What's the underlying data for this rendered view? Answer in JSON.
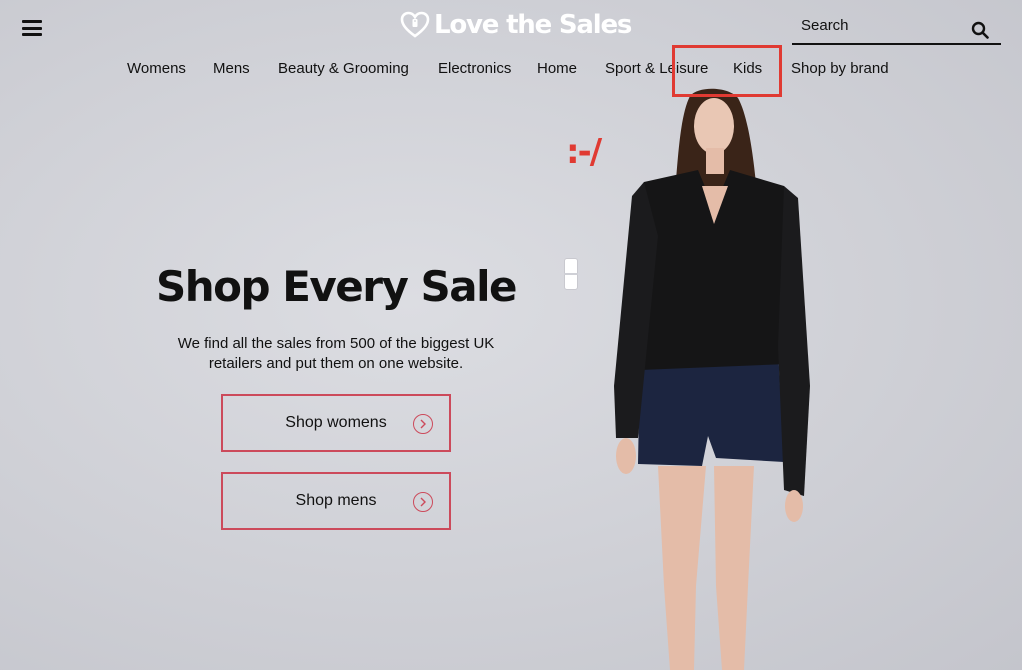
{
  "header": {
    "menu_icon": "hamburger-menu-icon",
    "logo": {
      "text": "Love the Sales",
      "icon": "heart-tag-icon",
      "color": "#ffffff"
    },
    "search": {
      "label": "Search",
      "icon": "search-icon"
    }
  },
  "nav": {
    "items": [
      {
        "label": "Womens"
      },
      {
        "label": "Mens"
      },
      {
        "label": "Beauty & Grooming"
      },
      {
        "label": "Electronics"
      },
      {
        "label": "Home"
      },
      {
        "label": "Sport & Leisure"
      },
      {
        "label": "Kids"
      },
      {
        "label": "Shop by brand"
      }
    ],
    "highlighted_item": "Kids",
    "highlight_color": "#e03a32"
  },
  "hero": {
    "emoticon": ":-/",
    "title": "Shop Every Sale",
    "subtitle_line1": "We find all the sales from 500 of the biggest UK",
    "subtitle_line2": "retailers and put them on one website.",
    "buttons": [
      {
        "label": "Shop womens",
        "icon": "chevron-right-circle-icon"
      },
      {
        "label": "Shop mens",
        "icon": "chevron-right-circle-icon"
      }
    ],
    "accent_color": "#cc4a5b"
  }
}
